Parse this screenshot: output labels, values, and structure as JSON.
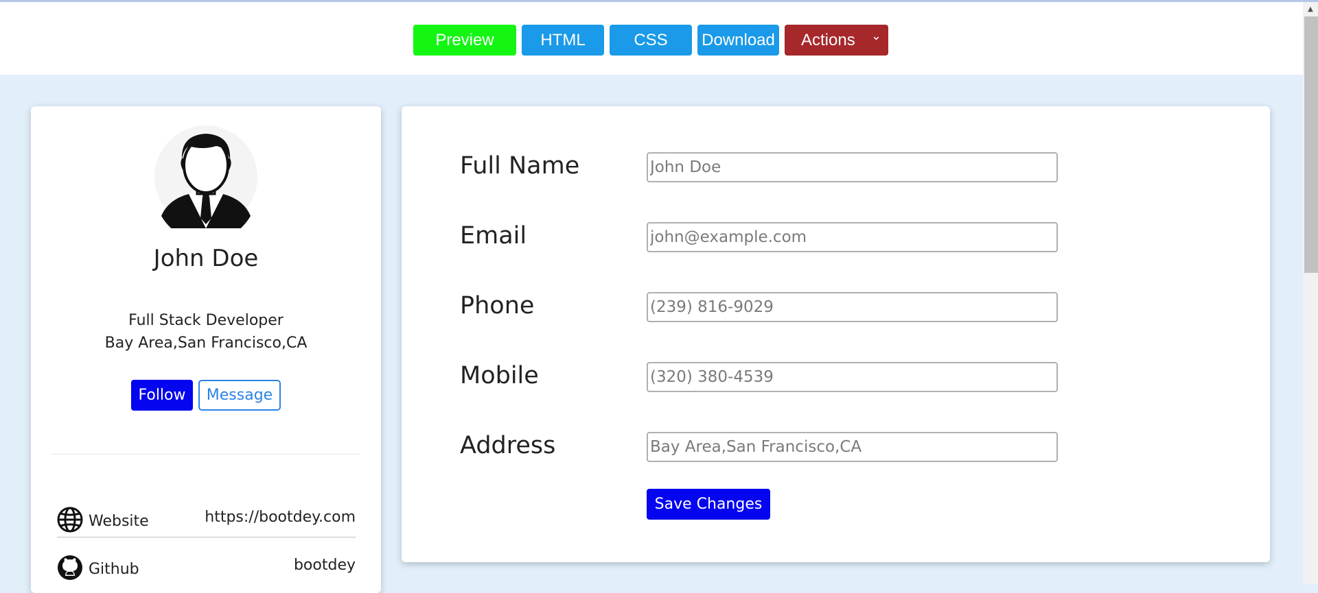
{
  "toolbar": {
    "preview": "Preview",
    "html": "HTML",
    "css": "CSS",
    "download": "Download",
    "actions": "Actions"
  },
  "profile": {
    "name": "John Doe",
    "title": "Full Stack Developer",
    "location": "Bay Area,San Francisco,CA",
    "follow": "Follow",
    "message": "Message",
    "links": [
      {
        "icon": "globe-icon",
        "label": "Website",
        "value": "https://bootdey.com"
      },
      {
        "icon": "github-icon",
        "label": "Github",
        "value": "bootdey"
      }
    ]
  },
  "form": {
    "fields": [
      {
        "label": "Full Name",
        "placeholder": "John Doe"
      },
      {
        "label": "Email",
        "placeholder": "john@example.com"
      },
      {
        "label": "Phone",
        "placeholder": "(239) 816-9029"
      },
      {
        "label": "Mobile",
        "placeholder": "(320) 380-4539"
      },
      {
        "label": "Address",
        "placeholder": "Bay Area,San Francisco,CA"
      }
    ],
    "save": "Save Changes"
  },
  "colors": {
    "preview": "#14f514",
    "primary": "#1a9ae8",
    "actions": "#a6282b",
    "follow": "#0505f0",
    "page_bg": "#e2effb"
  }
}
